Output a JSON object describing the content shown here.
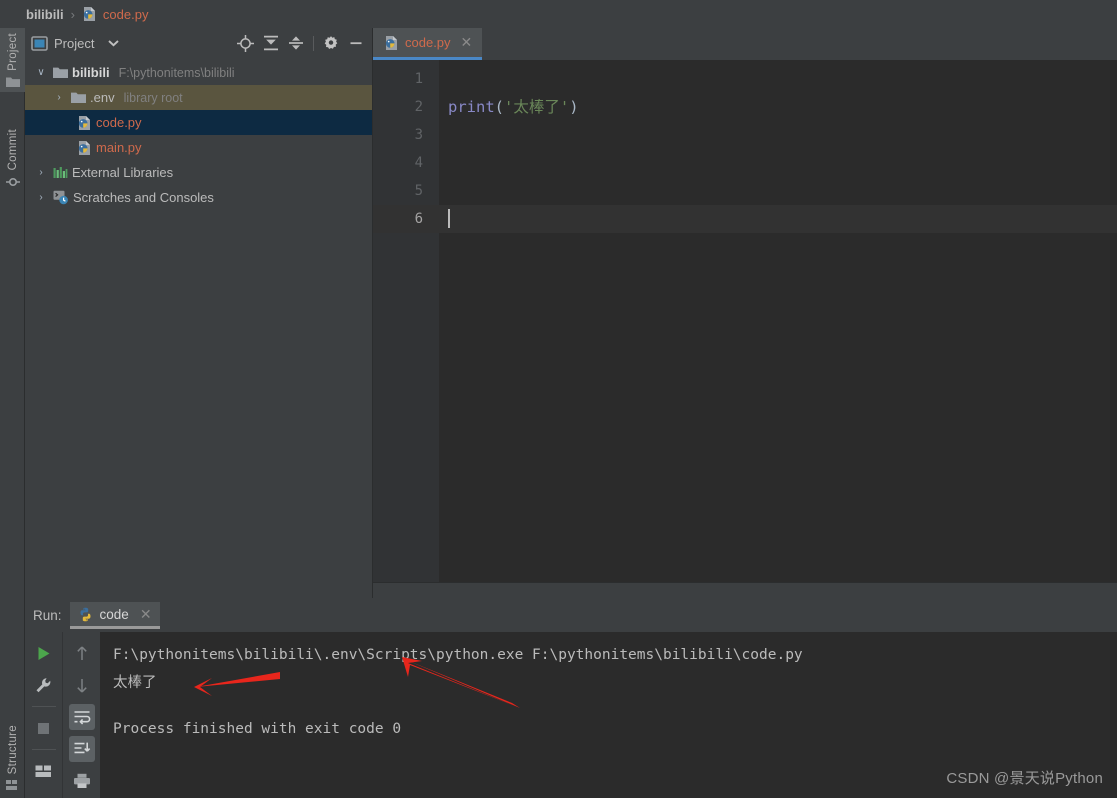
{
  "breadcrumb": {
    "project": "bilibili",
    "separator": "›",
    "file": "code.py",
    "file_icon": "python-file-icon"
  },
  "left_strip": {
    "tabs": [
      {
        "label": "Project",
        "icon": "folder-icon",
        "active": true
      },
      {
        "label": "Commit",
        "icon": "commit-icon",
        "active": false
      },
      {
        "label": "Structure",
        "icon": "structure-icon",
        "active": false
      }
    ]
  },
  "project_panel": {
    "title": "Project",
    "dropdown_icon": "chevron-down-icon",
    "panel_icon": "project-view-icon",
    "actions": [
      {
        "name": "locate-icon",
        "title": "Select Opened File"
      },
      {
        "name": "expand-all-icon",
        "title": "Expand All"
      },
      {
        "name": "collapse-all-icon",
        "title": "Collapse All"
      },
      {
        "name": "gear-icon",
        "title": "Options"
      },
      {
        "name": "minimize-icon",
        "title": "Hide"
      }
    ],
    "tree": [
      {
        "label": "bilibili",
        "sublabel": "F:\\pythonitems\\bilibili",
        "icon": "folder-icon",
        "arrow": "∨",
        "indent": 1,
        "state": "normal",
        "bold": true
      },
      {
        "label": ".env",
        "sublabel": "library root",
        "icon": "folder-icon",
        "arrow": "›",
        "indent": 2,
        "state": "hover",
        "bold": false
      },
      {
        "label": "code.py",
        "sublabel": "",
        "icon": "python-file-icon",
        "arrow": "",
        "indent": 3,
        "state": "selected",
        "bold": false
      },
      {
        "label": "main.py",
        "sublabel": "",
        "icon": "python-file-icon",
        "arrow": "",
        "indent": 3,
        "state": "normal",
        "bold": false
      },
      {
        "label": "External Libraries",
        "sublabel": "",
        "icon": "libraries-icon",
        "arrow": "›",
        "indent": 1,
        "state": "normal",
        "bold": false
      },
      {
        "label": "Scratches and Consoles",
        "sublabel": "",
        "icon": "scratches-icon",
        "arrow": "›",
        "indent": 1,
        "state": "normal",
        "bold": false
      }
    ]
  },
  "editor": {
    "tab": {
      "name": "code.py",
      "icon": "python-file-icon",
      "close_icon": "close-icon"
    },
    "line_numbers": [
      "1",
      "2",
      "3",
      "4",
      "5",
      "6"
    ],
    "current_line": 6,
    "code": {
      "line2": {
        "fn": "print",
        "open_paren": "(",
        "string": "'太棒了'",
        "close_paren": ")"
      }
    }
  },
  "run_panel": {
    "label": "Run:",
    "tab": {
      "name": "code",
      "icon": "python-icon",
      "close_icon": "close-icon"
    },
    "toolbar_left": [
      {
        "name": "run-icon",
        "title": "Rerun"
      },
      {
        "name": "wrench-icon",
        "title": "Edit Configuration"
      },
      {
        "name": "stop-icon",
        "title": "Stop"
      },
      {
        "name": "layout-icon",
        "title": "Layout Settings"
      }
    ],
    "toolbar_right": [
      {
        "name": "arrow-up-icon",
        "title": "Up"
      },
      {
        "name": "arrow-down-icon",
        "title": "Down"
      },
      {
        "name": "soft-wrap-icon",
        "title": "Soft-Wrap",
        "toggled": true
      },
      {
        "name": "scroll-to-end-icon",
        "title": "Scroll to End",
        "toggled": true
      },
      {
        "name": "print-icon",
        "title": "Print"
      }
    ],
    "console": {
      "command": "F:\\pythonitems\\bilibili\\.env\\Scripts\\python.exe F:\\pythonitems\\bilibili\\code.py",
      "output": "太棒了",
      "status": "Process finished with exit code 0"
    }
  },
  "annotations": {
    "arrow_color": "#e8261c",
    "arrow_output_label": "points-to-program-output",
    "arrow_command_label": "points-to-interpreter-path"
  },
  "watermark": "CSDN @景天说Python",
  "colors": {
    "window_bg": "#3c3f41",
    "editor_bg": "#2b2b2b",
    "gutter_bg": "#313335",
    "selection_bg": "#0d2a42",
    "hover_bg": "#5a553f",
    "tab_active_underline": "#4a88c7",
    "filename_red": "#cf6a4c",
    "string_green": "#6a8759",
    "builtin_purple": "#8888c6",
    "text_gray": "#bbbbbb",
    "annotation_red": "#e8261c"
  }
}
